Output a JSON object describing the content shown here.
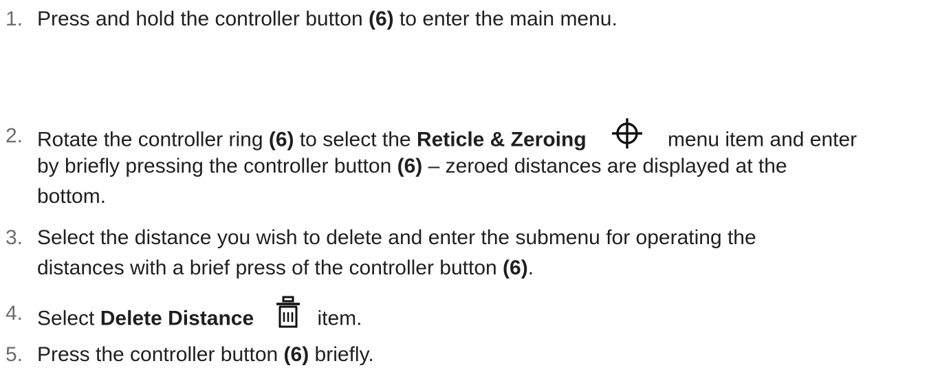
{
  "steps": [
    {
      "number": "1.",
      "parts": {
        "a": "Press and hold the controller button ",
        "b": "(6)",
        "c": " to enter the main menu."
      }
    },
    {
      "number": "2.",
      "parts": {
        "a": "Rotate the controller ring ",
        "b": "(6)",
        "c": " to select the ",
        "d": "Reticle & Zeroing",
        "e": " menu item and enter",
        "f": "by briefly pressing the controller button ",
        "g": "(6)",
        "h": " – zeroed distances are displayed at the",
        "i": "bottom."
      },
      "icon": "crosshair-icon"
    },
    {
      "number": "3.",
      "parts": {
        "a": "Select the distance you wish to delete and enter the submenu for operating the",
        "b": "distances with a brief press of the controller button ",
        "c": "(6)",
        "d": "."
      }
    },
    {
      "number": "4.",
      "parts": {
        "a": "Select ",
        "b": "Delete Distance",
        "c": " item."
      },
      "icon": "trash-icon"
    },
    {
      "number": "5.",
      "parts": {
        "a": "Press the controller button ",
        "b": "(6)",
        "c": " briefly."
      }
    }
  ]
}
